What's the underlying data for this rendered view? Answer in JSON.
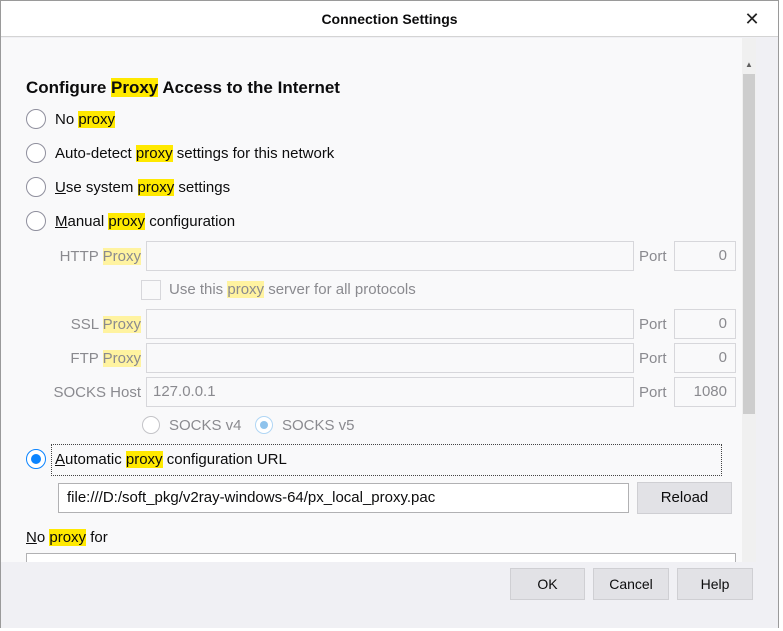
{
  "window": {
    "title": "Connection Settings",
    "close_glyph": "✕"
  },
  "section": {
    "title_pre": "Configure ",
    "title_hl": "Proxy",
    "title_post": " Access to the Internet"
  },
  "radios": {
    "no_proxy": {
      "pre": "No ",
      "hl": "proxy",
      "post": ""
    },
    "auto_detect": {
      "pre": "Auto-detect ",
      "hl": "proxy",
      "post": " settings for this network"
    },
    "system": {
      "u": "U",
      "pre": "se system ",
      "hl": "proxy",
      "post": " settings"
    },
    "manual": {
      "u": "M",
      "pre": "anual ",
      "hl": "proxy",
      "post": " configuration"
    },
    "auto_url": {
      "u": "A",
      "pre": "utomatic ",
      "hl": "proxy",
      "post": " configuration URL",
      "selected": true
    }
  },
  "manual": {
    "http": {
      "label_pre": "HTTP ",
      "label_hl": "Proxy",
      "value": "",
      "port_label": "Port",
      "port": "0"
    },
    "share": {
      "pre": "Use this ",
      "hl": "proxy",
      "post": " server for all protocols",
      "checked": false
    },
    "ssl": {
      "label_pre": "SSL ",
      "label_hl": "Proxy",
      "value": "",
      "port_label": "Port",
      "port": "0"
    },
    "ftp": {
      "label_pre": "FTP ",
      "label_hl": "Proxy",
      "value": "",
      "port_label": "Port",
      "port": "0"
    },
    "socks": {
      "label": "SOCKS Host",
      "value": "127.0.0.1",
      "port_label": "Port",
      "port": "1080"
    },
    "socks_v4": "SOCKS v4",
    "socks_v5": "SOCKS v5"
  },
  "auto_url": {
    "value": "file:///D:/soft_pkg/v2ray-windows-64/px_local_proxy.pac",
    "reload_label": "Reload"
  },
  "no_proxy_for": {
    "pre": "No ",
    "hl": "proxy",
    "post": " for",
    "value": ""
  },
  "buttons": {
    "ok": "OK",
    "cancel": "Cancel",
    "help": "Help"
  },
  "colors": {
    "accent": "#0a84ff",
    "highlight": "#ffe900"
  }
}
